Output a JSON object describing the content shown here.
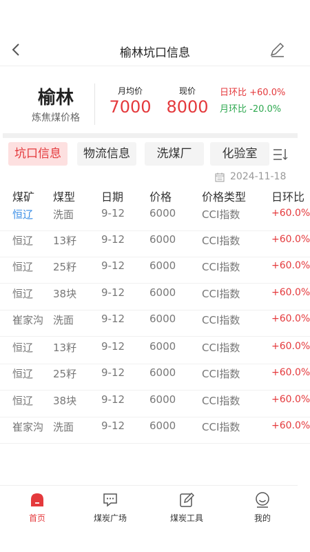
{
  "header": {
    "title": "榆林坑口信息"
  },
  "summary": {
    "city": "榆林",
    "subtitle": "炼焦煤价格",
    "monthly_avg_label": "月均价",
    "monthly_avg_value": "7000",
    "current_label": "现价",
    "current_value": "8000",
    "day_change": "日环比 +60.0%",
    "month_change": "月环比 -20.0%"
  },
  "tabs": [
    {
      "label": "坑口信息",
      "active": true
    },
    {
      "label": "物流信息",
      "active": false
    },
    {
      "label": "洗煤厂",
      "active": false
    },
    {
      "label": "化验室",
      "active": false
    }
  ],
  "date": "2024-11-18",
  "table": {
    "columns": [
      "煤矿",
      "煤型",
      "日期",
      "价格",
      "价格类型",
      "日环比"
    ],
    "rows": [
      [
        "恒辽",
        "洗面",
        "9-12",
        "6000",
        "CCI指数",
        "+60.0%"
      ],
      [
        "恒辽",
        "13籽",
        "9-12",
        "6000",
        "CCI指数",
        "+60.0%"
      ],
      [
        "恒辽",
        "25籽",
        "9-12",
        "6000",
        "CCI指数",
        "+60.0%"
      ],
      [
        "恒辽",
        "38块",
        "9-12",
        "6000",
        "CCI指数",
        "+60.0%"
      ],
      [
        "崔家沟",
        "洗面",
        "9-12",
        "6000",
        "CCI指数",
        "+60.0%"
      ],
      [
        "恒辽",
        "13籽",
        "9-12",
        "6000",
        "CCI指数",
        "+60.0%"
      ],
      [
        "恒辽",
        "25籽",
        "9-12",
        "6000",
        "CCI指数",
        "+60.0%"
      ],
      [
        "恒辽",
        "38块",
        "9-12",
        "6000",
        "CCI指数",
        "+60.0%"
      ],
      [
        "崔家沟",
        "洗面",
        "9-12",
        "6000",
        "CCI指数",
        "+60.0%"
      ]
    ]
  },
  "tabbar": [
    {
      "label": "首页",
      "icon": "home-icon",
      "active": true
    },
    {
      "label": "煤炭广场",
      "icon": "chat-icon",
      "active": false
    },
    {
      "label": "煤炭工具",
      "icon": "tool-edit-icon",
      "active": false
    },
    {
      "label": "我的",
      "icon": "profile-icon",
      "active": false
    }
  ],
  "colors": {
    "accent": "#e4393c",
    "down": "#2da84f",
    "link": "#3a8ee6"
  }
}
